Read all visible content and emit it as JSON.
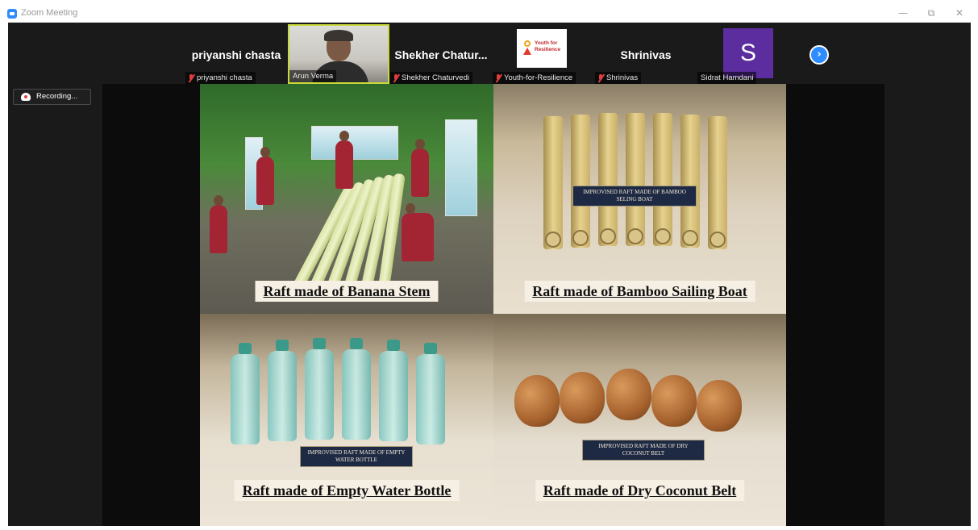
{
  "window": {
    "title": "Zoom Meeting",
    "minimize_glyph": "—",
    "restore_glyph": "⧉",
    "close_glyph": "✕"
  },
  "gallery": {
    "participants": [
      {
        "display_name": "priyanshi chasta",
        "label": "priyanshi chasta",
        "muted": true,
        "type": "name-only"
      },
      {
        "display_name": "",
        "label": "Arun Verma",
        "muted": false,
        "type": "video"
      },
      {
        "display_name": "Shekher  Chatur...",
        "label": "Shekher Chaturvedi",
        "muted": true,
        "type": "name-only"
      },
      {
        "display_name": "",
        "label": "Youth-for-Resilience",
        "muted": true,
        "type": "logo",
        "logo_text_1": "Youth for",
        "logo_text_2": "Resilience"
      },
      {
        "display_name": "Shrinivas",
        "label": "Shrinivas",
        "muted": true,
        "type": "name-only"
      },
      {
        "display_name": "",
        "label": "Sidrat Hamdani",
        "muted": false,
        "type": "avatar",
        "initial": "S",
        "avatar_color": "#5b2d9e"
      }
    ],
    "next_page_icon": "chevron-right-icon"
  },
  "recording": {
    "label": "Recording...",
    "icon": "cloud-recording-icon"
  },
  "slide": {
    "panels": [
      {
        "caption": "Raft made of Banana Stem",
        "plaque": ""
      },
      {
        "caption": "Raft made of Bamboo Sailing Boat",
        "plaque": "IMPROVISED RAFT MADE OF BAMBOO SELING BOAT"
      },
      {
        "caption": "Raft made of Empty Water Bottle",
        "plaque": "IMPROVISED RAFT MADE OF EMPTY WATER BOTTLE"
      },
      {
        "caption": "Raft made of Dry Coconut Belt",
        "plaque": "IMPROVISED RAFT MADE OF DRY COCONUT BELT"
      }
    ]
  },
  "colors": {
    "accent": "#2d8cff",
    "mute_red": "#e03e3e",
    "active_speaker": "#c8d93a"
  }
}
